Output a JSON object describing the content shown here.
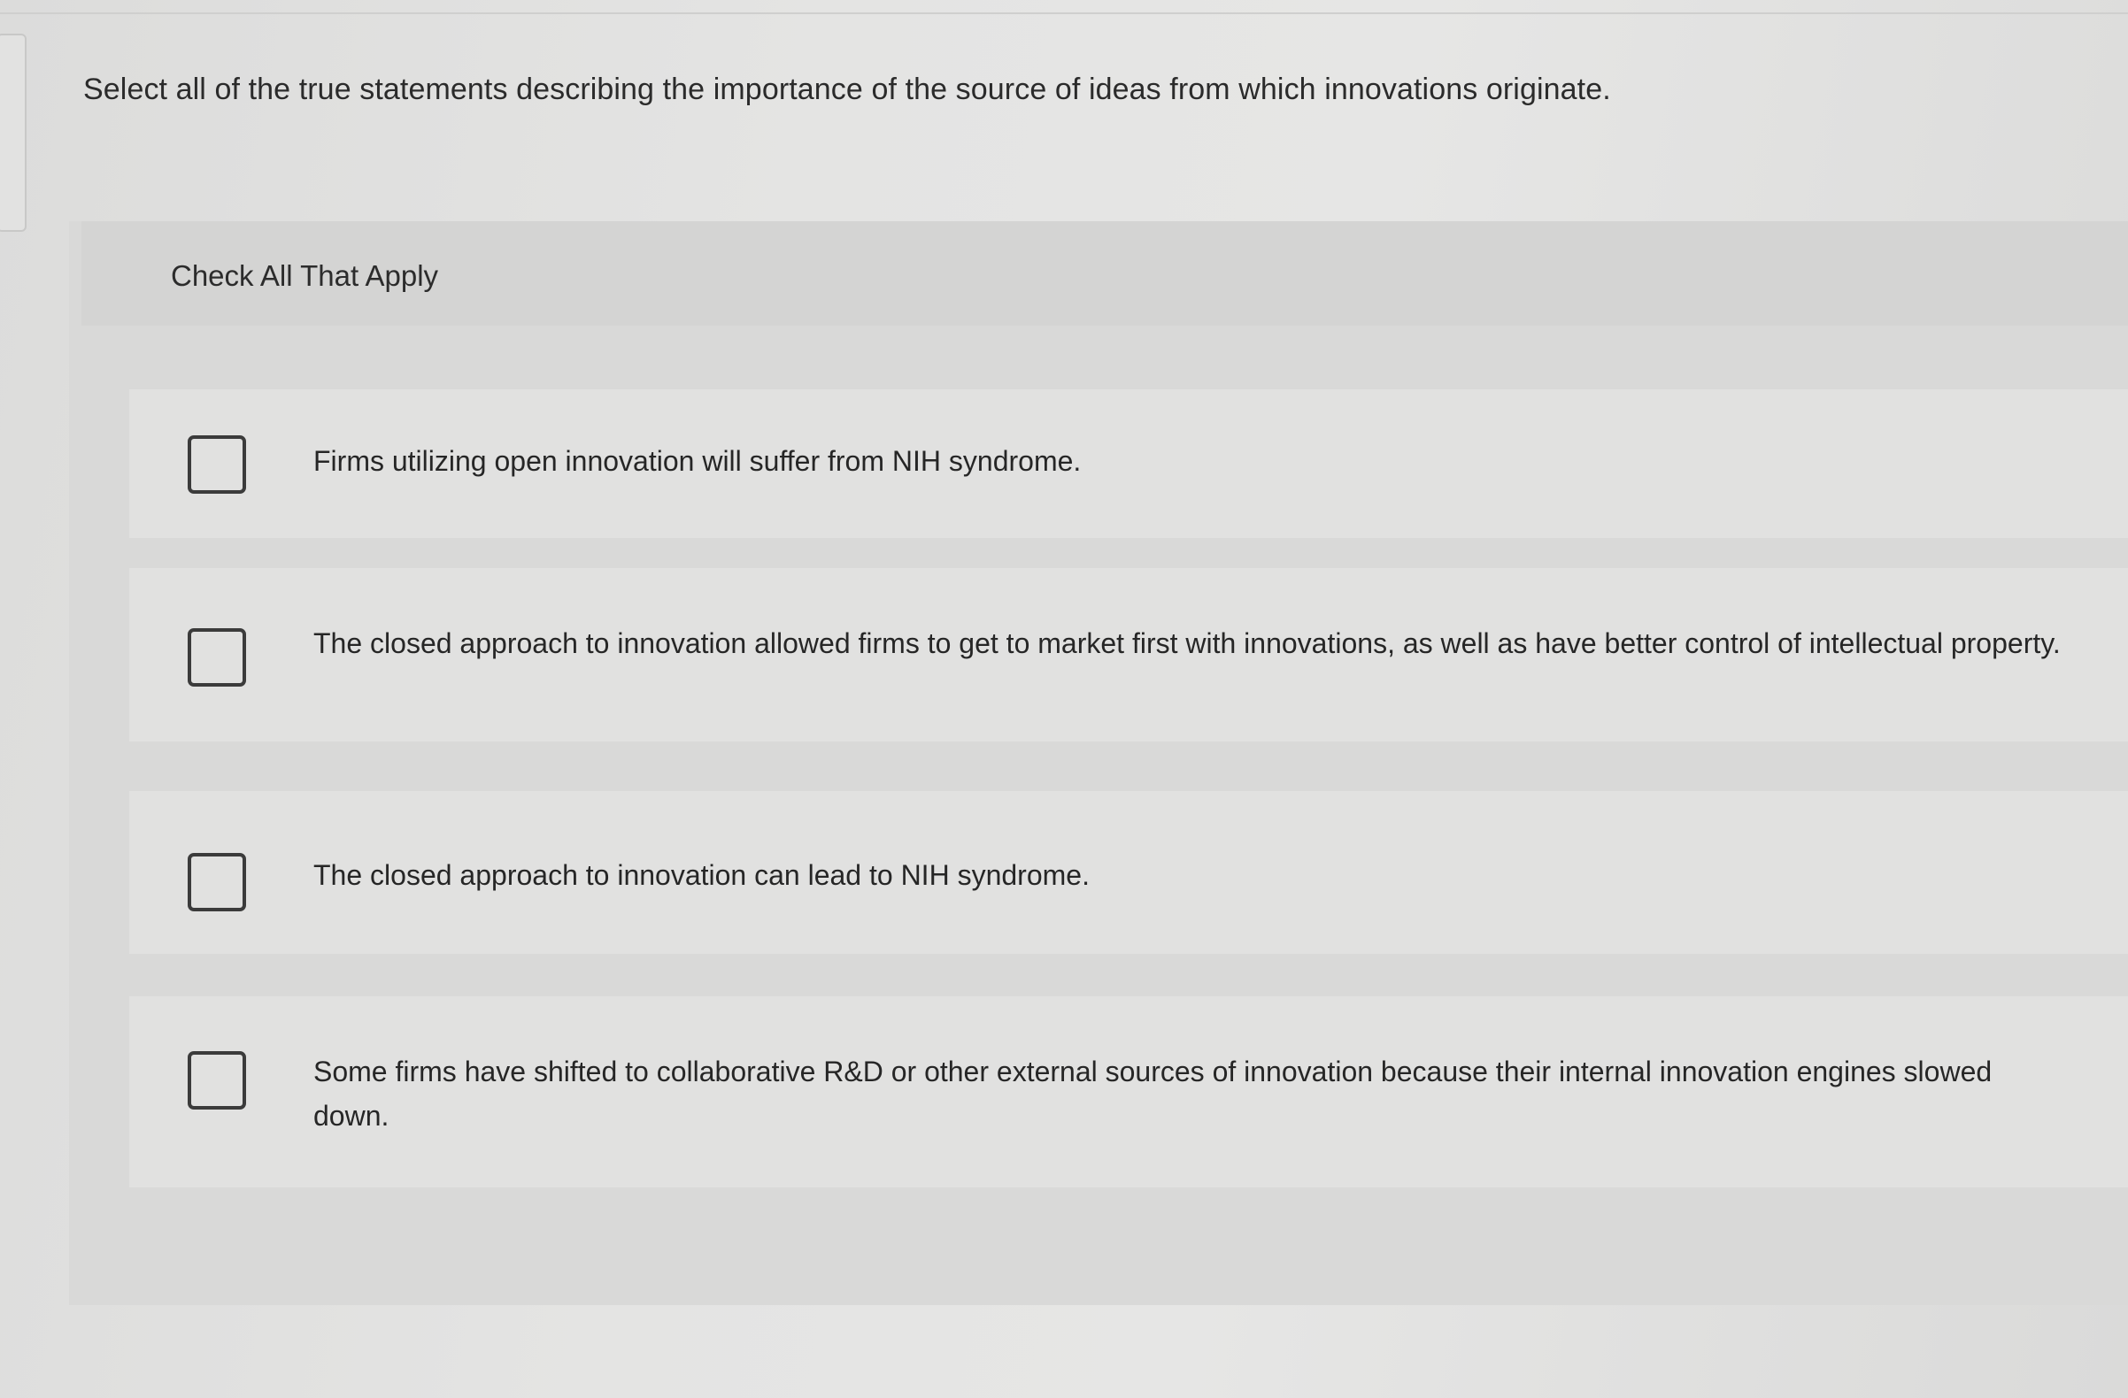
{
  "question": {
    "text": "Select all of the true statements describing the importance of the source of ideas from which innovations originate."
  },
  "panel": {
    "header_label": "Check All That Apply"
  },
  "options": [
    {
      "text": "Firms utilizing open innovation will suffer from NIH syndrome.",
      "checked": false
    },
    {
      "text": "The closed approach to innovation allowed firms to get to market first with innovations, as well as have better control of intellectual property.",
      "checked": false
    },
    {
      "text": "The closed approach to innovation can lead to NIH syndrome.",
      "checked": false
    },
    {
      "text": "Some firms have shifted to collaborative R&D or other external sources of innovation because their internal innovation engines slowed down.",
      "checked": false
    }
  ],
  "colors": {
    "background": "#e2e2e1",
    "panel": "#d9d9d8",
    "option_background": "#e1e1e0",
    "checkbox_border": "#3b3b3b",
    "text": "#2a2a2a"
  }
}
